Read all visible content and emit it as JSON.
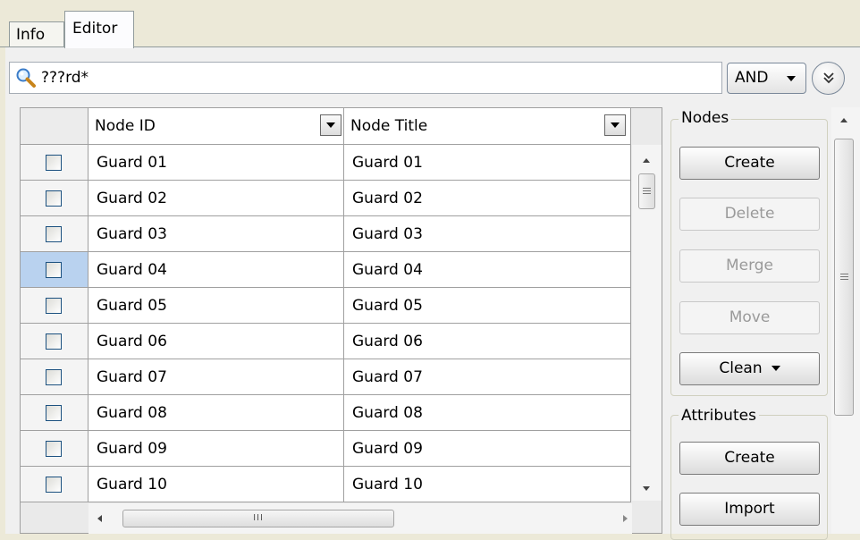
{
  "tabs": [
    {
      "label": "Info",
      "active": false
    },
    {
      "label": "Editor",
      "active": true
    }
  ],
  "search": {
    "value": "???rd*",
    "operator": "AND"
  },
  "grid": {
    "columns": [
      "Node ID",
      "Node Title"
    ],
    "rows": [
      {
        "id": "Guard 01",
        "title": "Guard 01",
        "checked": false
      },
      {
        "id": "Guard 02",
        "title": "Guard 02",
        "checked": false
      },
      {
        "id": "Guard 03",
        "title": "Guard 03",
        "checked": false
      },
      {
        "id": "Guard 04",
        "title": "Guard 04",
        "checked": false
      },
      {
        "id": "Guard 05",
        "title": "Guard 05",
        "checked": false
      },
      {
        "id": "Guard 06",
        "title": "Guard 06",
        "checked": false
      },
      {
        "id": "Guard 07",
        "title": "Guard 07",
        "checked": false
      },
      {
        "id": "Guard 08",
        "title": "Guard 08",
        "checked": false
      },
      {
        "id": "Guard 09",
        "title": "Guard 09",
        "checked": false
      },
      {
        "id": "Guard 10",
        "title": "Guard 10",
        "checked": false
      }
    ],
    "hscroll_grip": "III"
  },
  "nodes_group": {
    "label": "Nodes",
    "create": "Create",
    "delete": "Delete",
    "merge": "Merge",
    "move": "Move",
    "clean": "Clean"
  },
  "attributes_group": {
    "label": "Attributes",
    "create": "Create",
    "import": "Import"
  },
  "colors": {
    "window_bg": "#ece9d8",
    "selected_row_header": "#b9d2ef",
    "disabled_text": "#9a9a9a"
  }
}
